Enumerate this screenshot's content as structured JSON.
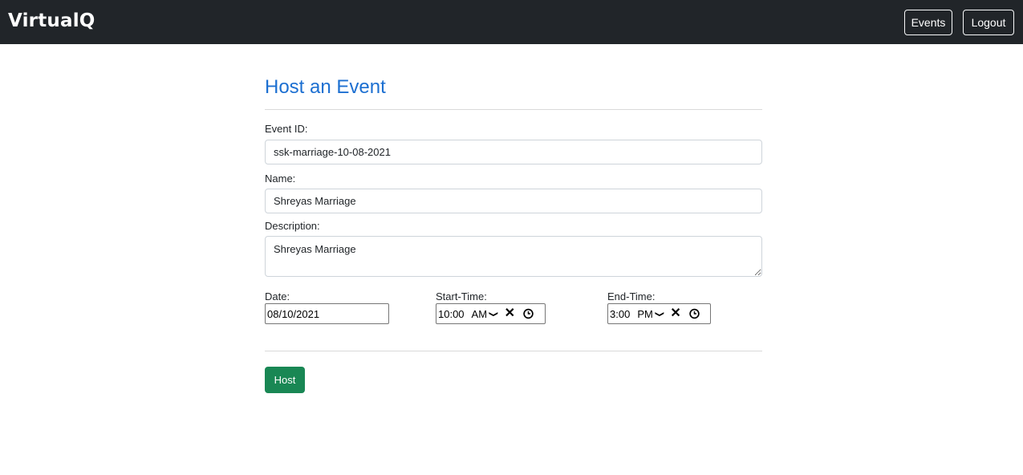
{
  "navbar": {
    "brand": "VirtualQ",
    "events_label": "Events",
    "logout_label": "Logout"
  },
  "form": {
    "title": "Host an Event",
    "event_id": {
      "label": "Event ID:",
      "value": "ssk-marriage-10-08-2021"
    },
    "name": {
      "label": "Name:",
      "value": "Shreyas Marriage"
    },
    "description": {
      "label": "Description:",
      "value": "Shreyas Marriage"
    },
    "date": {
      "label": "Date:",
      "value": "08/10/2021"
    },
    "start_time": {
      "label": "Start-Time:",
      "time": "10:00",
      "ampm": "AM"
    },
    "end_time": {
      "label": "End-Time:",
      "time": "3:00",
      "ampm": "PM"
    },
    "submit_label": "Host"
  },
  "colors": {
    "navbar_bg": "#212529",
    "title": "#1c6fd1",
    "host_button": "#198754"
  },
  "icons": {
    "dropdown": "chevron-down-icon",
    "clear": "close-icon",
    "clock": "clock-icon"
  }
}
